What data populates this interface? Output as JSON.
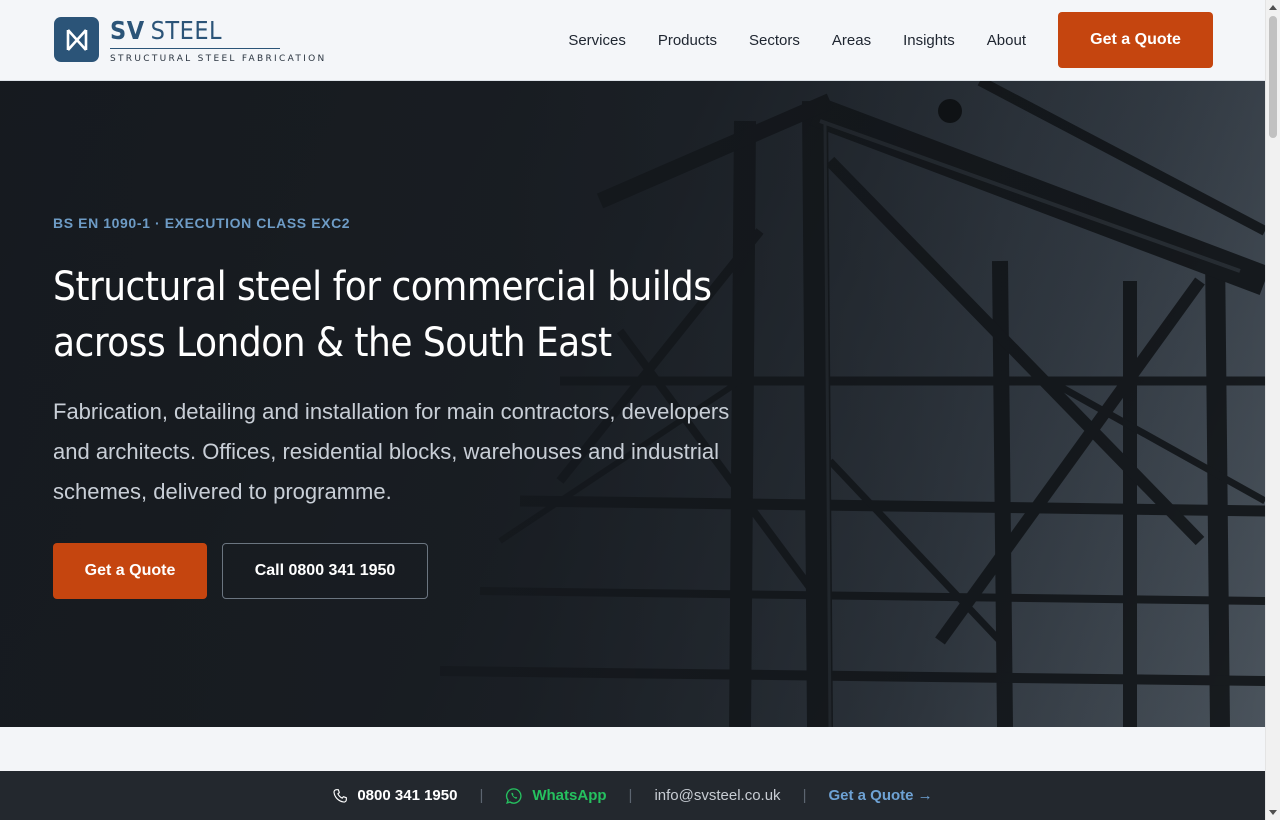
{
  "brand": {
    "name_bold": "SV",
    "name_light": "STEEL",
    "tagline": "STRUCTURAL STEEL FABRICATION",
    "color": "#2b5478",
    "logo_icon": "sv-monogram-icon"
  },
  "nav": {
    "items": [
      {
        "label": "Services"
      },
      {
        "label": "Products"
      },
      {
        "label": "Sectors"
      },
      {
        "label": "Areas"
      },
      {
        "label": "Insights"
      },
      {
        "label": "About"
      }
    ],
    "cta_label": "Get a Quote"
  },
  "hero": {
    "eyebrow": "BS EN 1090-1 · EXECUTION CLASS EXC2",
    "title": "Structural steel for commercial builds across London & the South East",
    "subtitle": "Fabrication, detailing and installation for main contractors, developers and architects. Offices, residential blocks, warehouses and industrial schemes, delivered to programme.",
    "primary_cta": "Get a Quote",
    "secondary_cta": "Call 0800 341 1950",
    "accent_color": "#c5450f"
  },
  "contact_bar": {
    "phone": "0800 341 1950",
    "whatsapp": "WhatsApp",
    "email": "info@svsteel.co.uk",
    "quote_link": "Get a Quote →",
    "separator": "|",
    "icons": {
      "phone": "phone-icon",
      "whatsapp": "whatsapp-icon"
    }
  }
}
